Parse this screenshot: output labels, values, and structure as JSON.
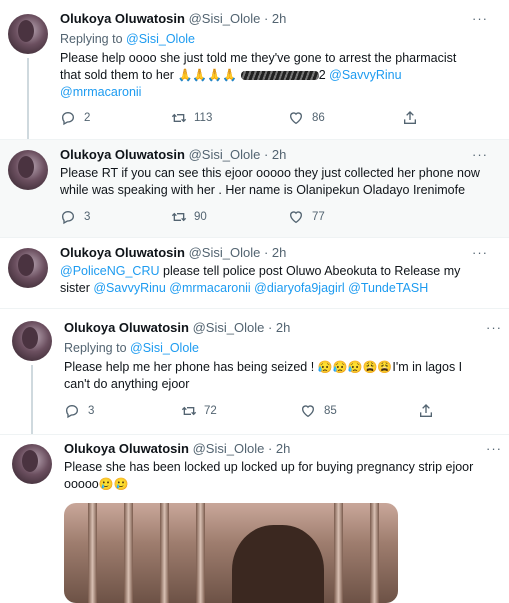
{
  "user": {
    "name": "Olukoya Oluwatosin",
    "handle": "@Sisi_Olole"
  },
  "tweets": [
    {
      "time": "· 2h",
      "more": "···",
      "reply_prefix": "Replying to",
      "reply_handle": "@Sisi_Olole",
      "line1": "Please help oooo she just told me they've gone to arrest the pharmacist",
      "line2_text": "that sold them to her",
      "line2_emojis": "🙏🙏🙏🙏",
      "line2_tail": "2",
      "line2_mention": "@SavvyRinu",
      "line3_mention": "@mrmacaronii",
      "reply_count": "2",
      "retweet_count": "113",
      "like_count": "86"
    },
    {
      "time": "· 2h",
      "more": "···",
      "line1": "Please RT if you can see this ejoor ooooo they just collected her phone now",
      "line2": "while  was speaking with her . Her name is Olanipekun Oladayo Irenimofe",
      "reply_count": "3",
      "retweet_count": "90",
      "like_count": "77"
    },
    {
      "time": "· 2h",
      "more": "···",
      "line1_mention": "@PoliceNG_CRU",
      "line1_text": " please tell police post Oluwo Abeokuta to Release my",
      "line2_text": "sister ",
      "line2_mentions": "@SavvyRinu @mrmacaronii @diaryofa9jagirl @TundeTASH"
    },
    {
      "time": "· 2h",
      "more": "···",
      "reply_prefix": "Replying to",
      "reply_handle": "@Sisi_Olole",
      "line1_text": "Please help me her phone has being seized ! ",
      "line1_emojis": "😥😥😥😩😩",
      "line1_tail": "I'm in lagos I",
      "line2": "can't do anything ejoor",
      "reply_count": "3",
      "retweet_count": "72",
      "like_count": "85"
    },
    {
      "time": "· 2h",
      "more": "···",
      "line1": "Please she has been locked up locked up for buying pregnancy strip ejoor",
      "line2_text": "ooooo",
      "line2_emojis": "🥲🥲"
    }
  ]
}
